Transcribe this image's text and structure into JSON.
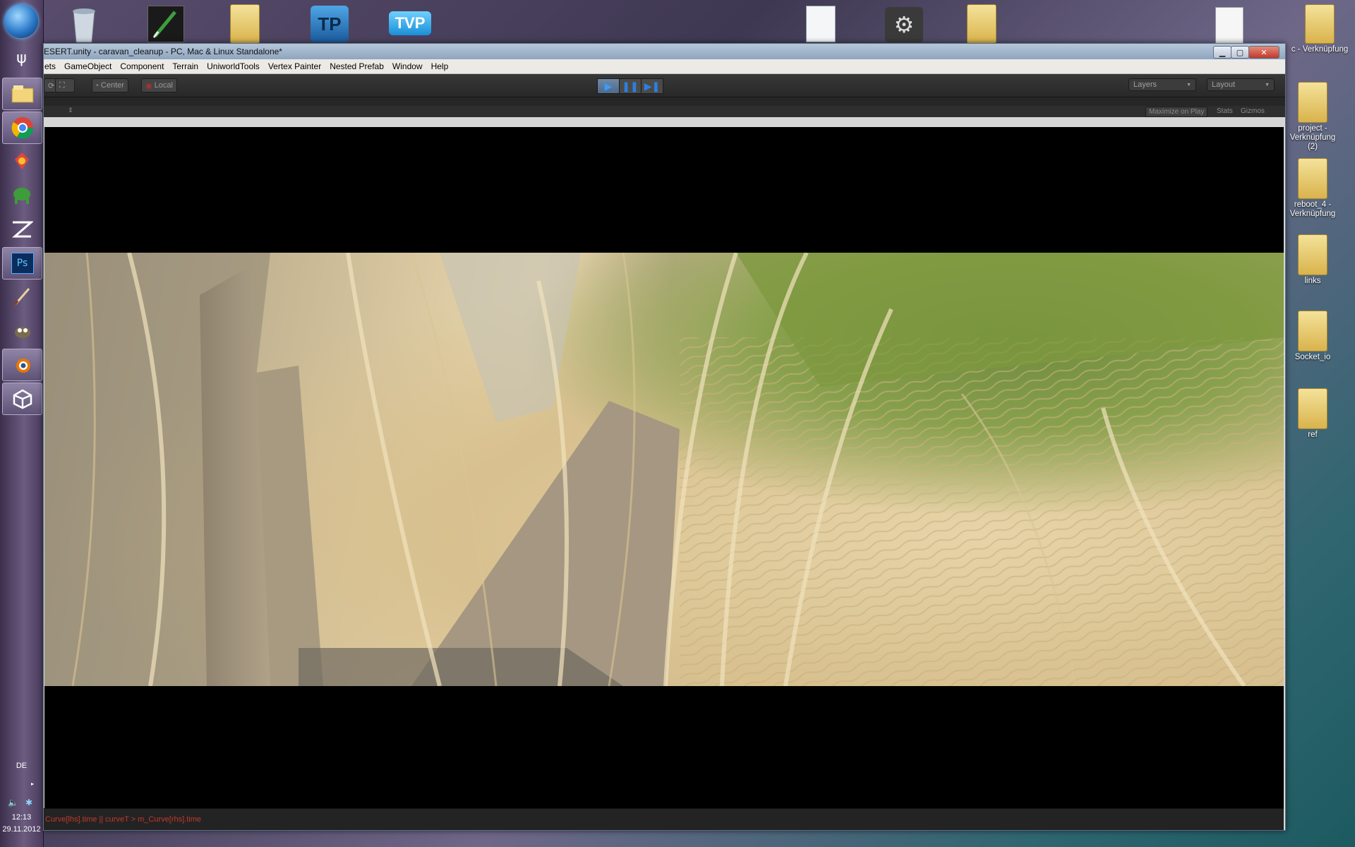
{
  "taskbar": {
    "language": "DE",
    "time": "12:13",
    "date": "29.11.2012",
    "apps": [
      "windows-start-icon",
      "psi-app-icon",
      "file-explorer-icon",
      "chrome-icon",
      "nvidia-icon",
      "app-green-icon",
      "zbrush-icon",
      "photoshop-icon",
      "pen-icon",
      "gimp-icon",
      "blender-icon",
      "unity-icon"
    ]
  },
  "desktop": {
    "right_icons": [
      {
        "label": "c - Verknüpfung"
      },
      {
        "label": "project - Verknüpfung (2)"
      },
      {
        "label": "reboot_4 - Verknüpfung"
      },
      {
        "label": "links"
      },
      {
        "label": "Socket_io"
      },
      {
        "label": "ref"
      }
    ],
    "top_icons": [
      "recycle-bin-icon",
      "inkscape-shortcut-icon",
      "folder-icon",
      "texturepacker-shortcut-icon",
      "tvpaint-shortcut-icon",
      "document-icon",
      "settings-icon",
      "folder-icon",
      "text-file-icon",
      "folder-icon"
    ]
  },
  "window": {
    "title": "ESERT.unity - caravan_cleanup - PC, Mac & Linux Standalone*",
    "menu": [
      "ets",
      "GameObject",
      "Component",
      "Terrain",
      "UniworldTools",
      "Vertex Painter",
      "Nested Prefab",
      "Window",
      "Help"
    ],
    "toolbar": {
      "pivot": "Center",
      "space": "Local",
      "layers": "Layers",
      "layout": "Layout"
    },
    "gamebar": {
      "maximize": "Maximize on Play",
      "stats": "Stats",
      "gizmos": "Gizmos"
    },
    "status": "Curve[lhs].time || curveT > m_Curve[rhs].time"
  }
}
